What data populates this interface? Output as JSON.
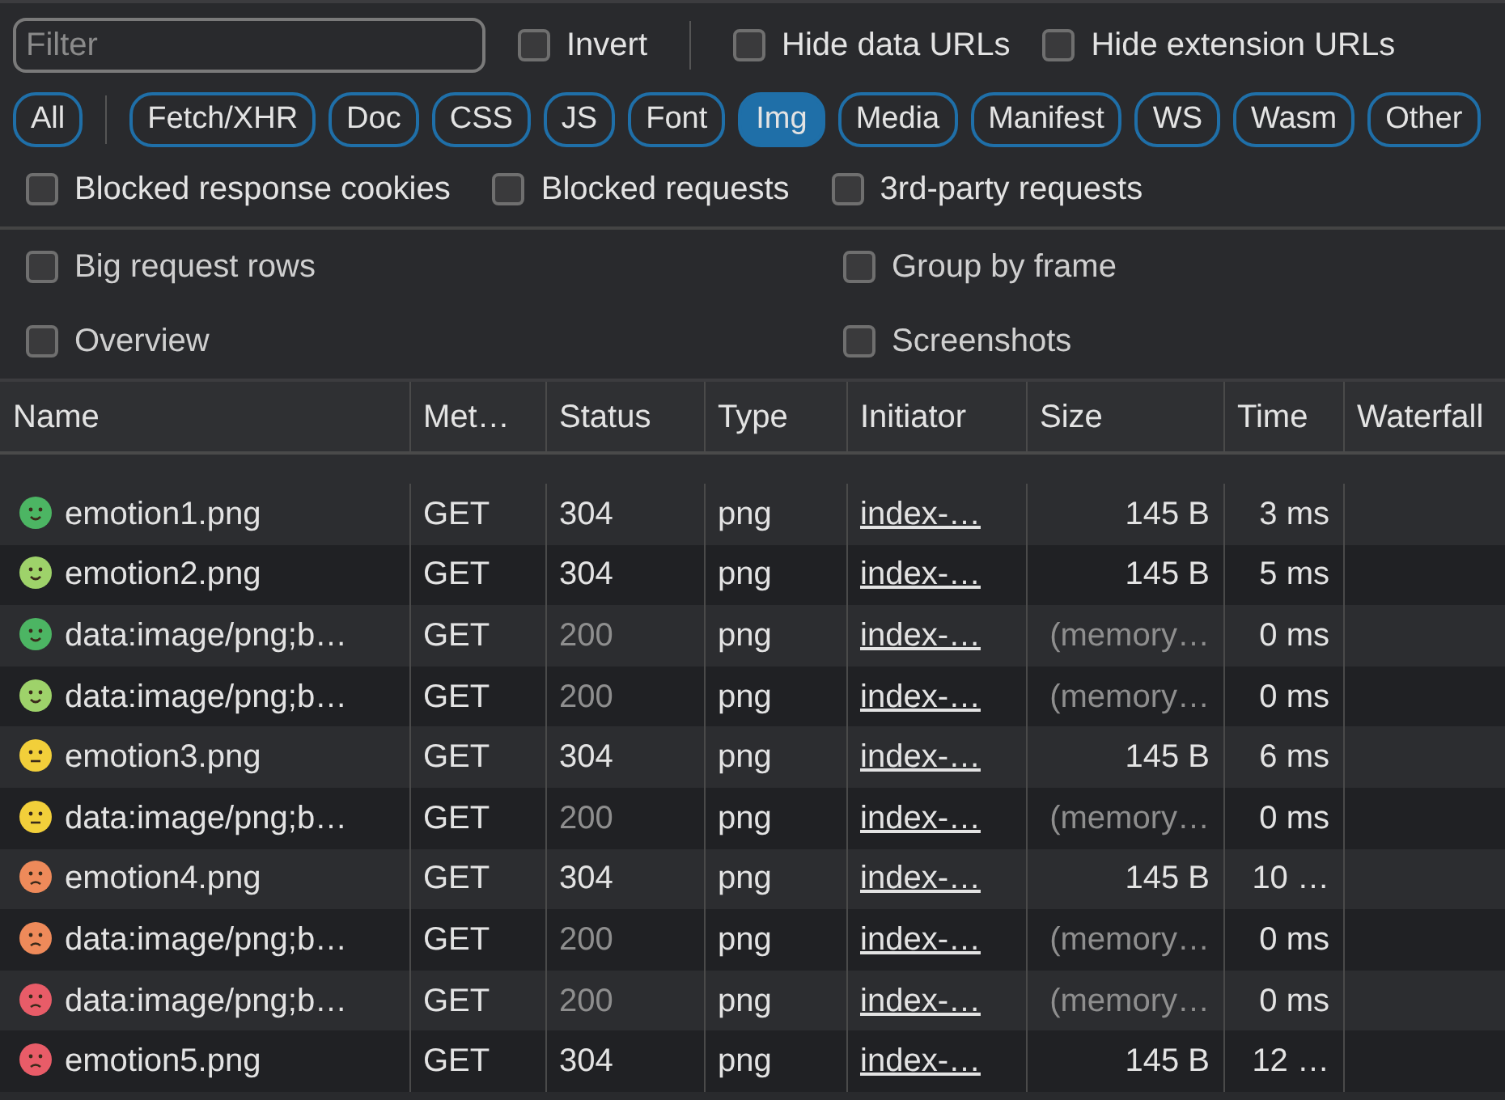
{
  "filter": {
    "placeholder": "Filter"
  },
  "top_option_groups": [
    [
      {
        "label": "Invert",
        "checked": false
      }
    ],
    [
      {
        "label": "Hide data URLs",
        "checked": false
      },
      {
        "label": "Hide extension URLs",
        "checked": false
      }
    ]
  ],
  "type_filter_groups": [
    [
      {
        "label": "All",
        "selected": false
      }
    ],
    [
      {
        "label": "Fetch/XHR",
        "selected": false
      },
      {
        "label": "Doc",
        "selected": false
      },
      {
        "label": "CSS",
        "selected": false
      },
      {
        "label": "JS",
        "selected": false
      },
      {
        "label": "Font",
        "selected": false
      },
      {
        "label": "Img",
        "selected": true
      },
      {
        "label": "Media",
        "selected": false
      },
      {
        "label": "Manifest",
        "selected": false
      },
      {
        "label": "WS",
        "selected": false
      },
      {
        "label": "Wasm",
        "selected": false
      },
      {
        "label": "Other",
        "selected": false
      }
    ]
  ],
  "blocked_options": [
    {
      "label": "Blocked response cookies",
      "checked": false
    },
    {
      "label": "Blocked requests",
      "checked": false
    },
    {
      "label": "3rd-party requests",
      "checked": false
    }
  ],
  "settings": [
    {
      "label": "Big request rows",
      "checked": false
    },
    {
      "label": "Group by frame",
      "checked": false
    },
    {
      "label": "Overview",
      "checked": false
    },
    {
      "label": "Screenshots",
      "checked": false
    }
  ],
  "table": {
    "columns": [
      "Name",
      "Met…",
      "Status",
      "Type",
      "Initiator",
      "Size",
      "Time",
      "Waterfall"
    ],
    "rows": [
      {
        "name": "emotion1.png",
        "kind": "smile",
        "color": "#4cb563",
        "method": "GET",
        "status": "304",
        "type": "png",
        "initiator": "index-…",
        "size": "145 B",
        "time": "3 ms",
        "cached": false
      },
      {
        "name": "emotion2.png",
        "kind": "smile",
        "color": "#9ed26a",
        "method": "GET",
        "status": "304",
        "type": "png",
        "initiator": "index-…",
        "size": "145 B",
        "time": "5 ms",
        "cached": false
      },
      {
        "name": "data:image/png;b…",
        "kind": "smile",
        "color": "#4cb563",
        "method": "GET",
        "status": "200",
        "type": "png",
        "initiator": "index-…",
        "size": "(memory…",
        "time": "0 ms",
        "cached": true
      },
      {
        "name": "data:image/png;b…",
        "kind": "smile",
        "color": "#9ed26a",
        "method": "GET",
        "status": "200",
        "type": "png",
        "initiator": "index-…",
        "size": "(memory…",
        "time": "0 ms",
        "cached": true
      },
      {
        "name": "emotion3.png",
        "kind": "neutral",
        "color": "#f2cf3a",
        "method": "GET",
        "status": "304",
        "type": "png",
        "initiator": "index-…",
        "size": "145 B",
        "time": "6 ms",
        "cached": false
      },
      {
        "name": "data:image/png;b…",
        "kind": "neutral",
        "color": "#f2cf3a",
        "method": "GET",
        "status": "200",
        "type": "png",
        "initiator": "index-…",
        "size": "(memory…",
        "time": "0 ms",
        "cached": true
      },
      {
        "name": "emotion4.png",
        "kind": "frown",
        "color": "#ee8a5a",
        "method": "GET",
        "status": "304",
        "type": "png",
        "initiator": "index-…",
        "size": "145 B",
        "time": "10 …",
        "cached": false
      },
      {
        "name": "data:image/png;b…",
        "kind": "frown",
        "color": "#ee8a5a",
        "method": "GET",
        "status": "200",
        "type": "png",
        "initiator": "index-…",
        "size": "(memory…",
        "time": "0 ms",
        "cached": true
      },
      {
        "name": "data:image/png;b…",
        "kind": "frown",
        "color": "#e85c68",
        "method": "GET",
        "status": "200",
        "type": "png",
        "initiator": "index-…",
        "size": "(memory…",
        "time": "0 ms",
        "cached": true
      },
      {
        "name": "emotion5.png",
        "kind": "frown",
        "color": "#e85c68",
        "method": "GET",
        "status": "304",
        "type": "png",
        "initiator": "index-…",
        "size": "145 B",
        "time": "12 …",
        "cached": false
      }
    ]
  }
}
